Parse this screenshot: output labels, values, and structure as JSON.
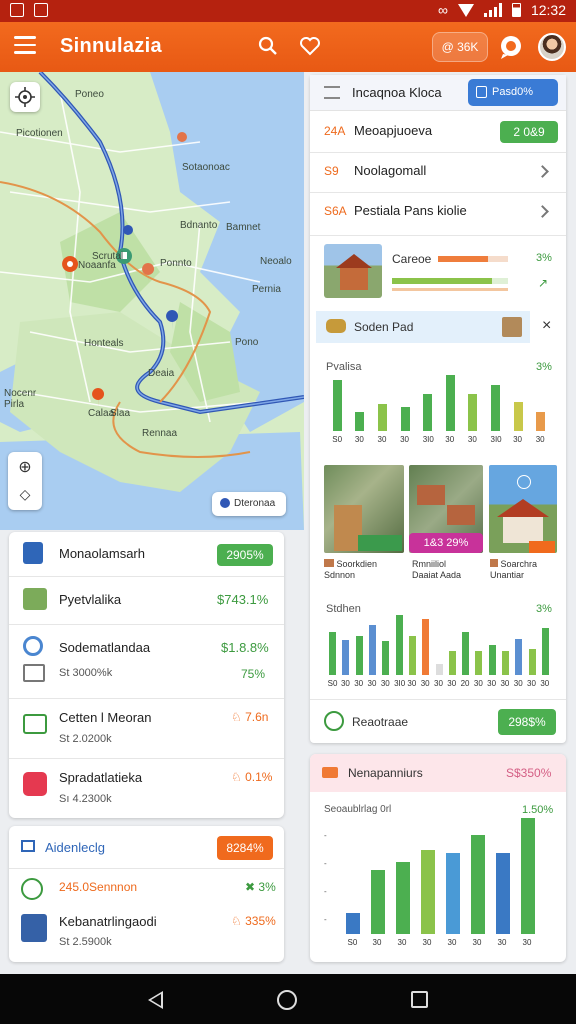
{
  "status_bar": {
    "time": "12:32",
    "left_icons": [
      "gallery-icon",
      "notification-icon"
    ],
    "right_icons": [
      "alarm-icon",
      "wifi-icon",
      "signal-icon",
      "battery-icon"
    ]
  },
  "app_bar": {
    "title": "Sinnulazia",
    "pill_text": "@ 36K"
  },
  "map": {
    "labels": [
      "Poneo",
      "Picotionen",
      "Sotaonoac",
      "Bdnanto",
      "Bamnet",
      "Scrutal",
      "Ponnto",
      "Noaanfa",
      "Neoalo",
      "Pernia",
      "Honteals",
      "Pono",
      "Deaia",
      "Calaa",
      "Nocenr Pirla",
      "Rennaa",
      "Slaa"
    ],
    "chip_label": "Dteronaa",
    "colors": {
      "water": "#a9cdf1",
      "land": "#d7ecc6",
      "route_blue": "#3057b5",
      "route_orange": "#e2944a"
    }
  },
  "right_panel": {
    "header_title": "Incaqnoa Kloca",
    "header_button": "Pasd0%",
    "list": [
      {
        "num": "24A",
        "label": "Meoapjuoeva",
        "badge": "2 0&9"
      },
      {
        "num": "S9",
        "label": "Noolagomall"
      },
      {
        "num": "S6A",
        "label": "Pestiala Pans kiolie"
      }
    ],
    "progress_card": {
      "label": "Careoe",
      "pct": "3%",
      "fill_1": 0.72,
      "fill_2": 0.86
    },
    "promo": {
      "label": "Soden Pad"
    },
    "chart1": {
      "title": "Pvalisa",
      "value": "3%"
    },
    "images": [
      {
        "badge": "",
        "caption": "Soorkdien\nSdnnon"
      },
      {
        "badge": "1&3 29%",
        "caption": "Rmniiliol\nDaaiat Aada"
      },
      {
        "badge": "",
        "caption": "Soarchra\nUnantiar"
      }
    ],
    "chart2": {
      "title": "Stdhen",
      "value": "3%"
    },
    "footer": {
      "label": "Reaotraae",
      "badge": "298$%"
    }
  },
  "left_cards": {
    "card1": {
      "rows": [
        {
          "title": "Monaolamsarh",
          "badge": "2905%",
          "icon": "bookmark-icon"
        },
        {
          "title": "Pyetvlalika",
          "value": "$743.1%",
          "icon": "app-icon"
        },
        {
          "title": "Sodematlandaa",
          "sub": "St 3000%k",
          "value": "$1.8.8%",
          "value2": "75%",
          "icon": "clock-icon"
        },
        {
          "title": "Cetten l Meoran",
          "sub": "St 2.0200k",
          "value": "♘ 7.6n",
          "icon": "window-icon"
        },
        {
          "title": "Spradatlatieka",
          "sub": "Sı 4.2300k",
          "value": "♘ 0.1%",
          "icon": "gift-icon"
        }
      ]
    },
    "card2": {
      "title": "Aidenleclg",
      "badge": "8284%",
      "rows": [
        {
          "title": "245.0Sennnon",
          "value": "✖ 3%",
          "icon": "sun-icon"
        },
        {
          "title": "Kebanatrlingaodi",
          "sub": "St 2.5900k",
          "value": "♘ 335%",
          "icon": "house-icon"
        }
      ]
    }
  },
  "bottom_right_card": {
    "title": "Nenapanniurs",
    "badge": "S$350%",
    "chart_title": "Seoaublrlag 0rl",
    "chart_value": "1.50%"
  },
  "chart_data": [
    {
      "type": "bar",
      "title": "Pvalisa",
      "categories": [
        "S0",
        "30",
        "30",
        "30",
        "3I0",
        "30",
        "30",
        "3I0",
        "30",
        "30"
      ],
      "series": [
        {
          "values": [
            42,
            16,
            22,
            20,
            30,
            46,
            30,
            38,
            24,
            16
          ]
        }
      ],
      "colors": [
        "#4caf50",
        "#4caf50",
        "#8bc34a",
        "#4caf50",
        "#4caf50",
        "#4caf50",
        "#8bc34a",
        "#4caf50",
        "#c8c84a",
        "#e89a4a"
      ]
    },
    {
      "type": "bar",
      "title": "Stdhen",
      "categories": [
        "S0",
        "30",
        "30",
        "30",
        "30",
        "3I0",
        "30",
        "30",
        "30",
        "30",
        "20",
        "30",
        "30",
        "30",
        "30",
        "30",
        "30"
      ],
      "series": [
        {
          "values": [
            40,
            33,
            36,
            47,
            32,
            56,
            36,
            52,
            10,
            22,
            40,
            22,
            28,
            22,
            34,
            24,
            44
          ]
        }
      ],
      "colors": [
        "#4caf50",
        "#5b8fd1",
        "#4caf50",
        "#5b8fd1",
        "#4caf50",
        "#4caf50",
        "#8bc34a",
        "#f07a35",
        "#dddddd",
        "#8bc34a",
        "#4caf50",
        "#8bc34a",
        "#4caf50",
        "#8bc34a",
        "#5b8fd1",
        "#8bc34a",
        "#4caf50"
      ]
    },
    {
      "type": "bar",
      "title": "Seoaublrlag 0rl",
      "categories": [
        "S0",
        "30",
        "30",
        "30",
        "30",
        "30",
        "30",
        "30"
      ],
      "series": [
        {
          "values": [
            18,
            55,
            62,
            72,
            70,
            85,
            70,
            100
          ]
        }
      ],
      "colors": [
        "#3a79c4",
        "#4caf50",
        "#4caf50",
        "#8bc34a",
        "#4a9ad6",
        "#4caf50",
        "#3a79c4",
        "#4caf50"
      ]
    }
  ]
}
